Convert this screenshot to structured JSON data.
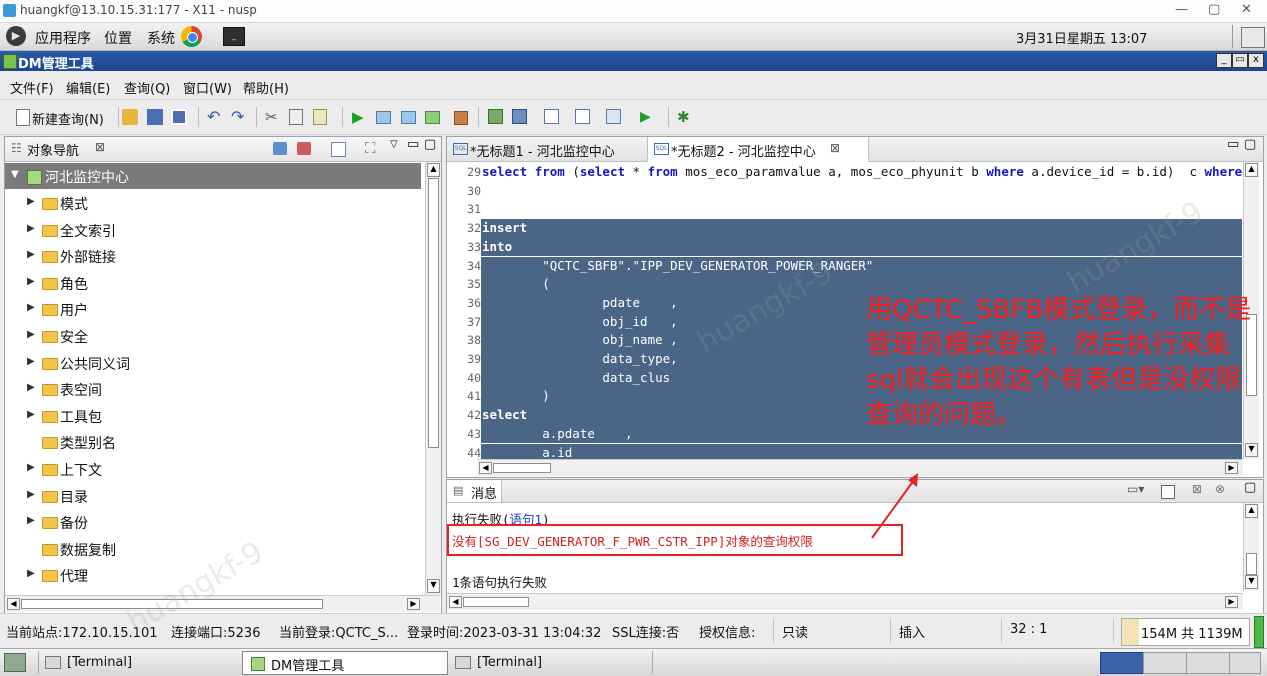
{
  "window": {
    "title": "huangkf@13.10.15.31:177 - X11 - nusp",
    "controls": [
      "—",
      "▢",
      "✕"
    ]
  },
  "panel": {
    "menus": [
      "应用程序",
      "位置",
      "系统"
    ],
    "datetime": "3月31日星期五 13:07"
  },
  "app": {
    "title": "DM管理工具",
    "mdi_controls": [
      "_",
      "▭",
      "x"
    ]
  },
  "menubar": {
    "items": [
      "文件(F)",
      "编辑(E)",
      "查询(Q)",
      "窗口(W)",
      "帮助(H)"
    ]
  },
  "toolbar": {
    "new_query": "新建查询(N)"
  },
  "navigator": {
    "title": "对象导航",
    "root": "河北监控中心",
    "items": [
      {
        "label": "模式",
        "expandable": true
      },
      {
        "label": "全文索引",
        "expandable": true
      },
      {
        "label": "外部链接",
        "expandable": true
      },
      {
        "label": "角色",
        "expandable": true
      },
      {
        "label": "用户",
        "expandable": true
      },
      {
        "label": "安全",
        "expandable": true
      },
      {
        "label": "公共同义词",
        "expandable": true
      },
      {
        "label": "表空间",
        "expandable": true
      },
      {
        "label": "工具包",
        "expandable": true
      },
      {
        "label": "类型别名",
        "expandable": false
      },
      {
        "label": "上下文",
        "expandable": true
      },
      {
        "label": "目录",
        "expandable": true
      },
      {
        "label": "备份",
        "expandable": true
      },
      {
        "label": "数据复制",
        "expandable": false
      },
      {
        "label": "代理",
        "expandable": true
      }
    ]
  },
  "editor": {
    "tabs": [
      {
        "label": "*无标题1 - 河北监控中心",
        "active": false
      },
      {
        "label": "*无标题2 - 河北监控中心",
        "active": true
      }
    ],
    "lines": [
      {
        "n": "29",
        "text": "select from (select * from mos_eco_paramvalue a, mos_eco_phyunit b where a.device_id = b.id)  c where c.de",
        "selected": false
      },
      {
        "n": "30",
        "text": "",
        "selected": false
      },
      {
        "n": "31",
        "text": "",
        "selected": false
      },
      {
        "n": "32",
        "text": "insert",
        "selected": true
      },
      {
        "n": "33",
        "text": "into",
        "selected": true
      },
      {
        "n": "34",
        "text": "        \"QCTC_SBFB\".\"IPP_DEV_GENERATOR_POWER_RANGER\"",
        "selected": true
      },
      {
        "n": "35",
        "text": "        (",
        "selected": true
      },
      {
        "n": "36",
        "text": "                pdate    ,",
        "selected": true
      },
      {
        "n": "37",
        "text": "                obj_id   ,",
        "selected": true
      },
      {
        "n": "38",
        "text": "                obj_name ,",
        "selected": true
      },
      {
        "n": "39",
        "text": "                data_type,",
        "selected": true
      },
      {
        "n": "40",
        "text": "                data_clus",
        "selected": true
      },
      {
        "n": "41",
        "text": "        )",
        "selected": true
      },
      {
        "n": "42",
        "text": "select",
        "selected": true
      },
      {
        "n": "43",
        "text": "        a.pdate    ,",
        "selected": true
      },
      {
        "n": "44",
        "text": "        a.id",
        "selected": true
      }
    ],
    "selection_color": "#4a6585"
  },
  "messages": {
    "title": "消息",
    "fail_prefix": "执行失败(",
    "fail_link": "语句1",
    "fail_suffix": ")",
    "error": "没有[SG_DEV_GENERATOR_F_PWR_CSTR_IPP]对象的查询权限",
    "summary": "1条语句执行失败"
  },
  "annotation": {
    "text": "用QCTC_SBFB模式登录，而不是管理员模式登录，然后执行采集sql就会出现这个有表但是没权限查询的问题。",
    "color": "#ff1a1a"
  },
  "statusbar": {
    "site": "当前站点:172.10.15.101",
    "port": "连接端口:5236",
    "login": "当前登录:QCTC_S...",
    "login_time": "登录时间:2023-03-31 13:04:32",
    "ssl": "SSL连接:否",
    "license": "授权信息:",
    "mode": "只读",
    "insert": "插入",
    "position": "32 : 1",
    "memory": "154M 共 1139M"
  },
  "taskbar": {
    "tasks": [
      "[Terminal]",
      "DM管理工具",
      "[Terminal]"
    ]
  },
  "watermark": "huangkf-9"
}
